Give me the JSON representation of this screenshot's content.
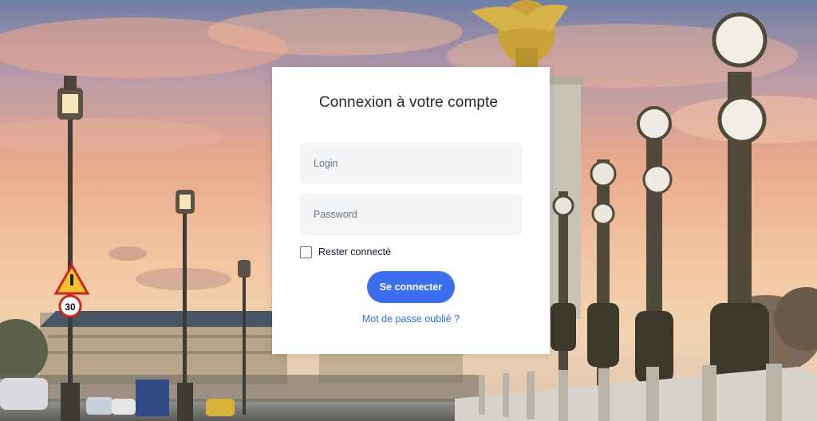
{
  "login_card": {
    "title": "Connexion à votre compte",
    "login_placeholder": "Login",
    "password_placeholder": "Password",
    "remember_label": "Rester connecté",
    "remember_checked": false,
    "submit_label": "Se connecter",
    "forgot_label": "Mot de passe oublié ?"
  },
  "background": {
    "speed_limit_sign": "30"
  },
  "colors": {
    "accent": "#3b6ff0",
    "link": "#2f6fe0",
    "field_bg": "#f3f4f6",
    "card_bg": "#ffffff",
    "sky_top": "#7a86a8",
    "sky_mid": "#e9a88a",
    "sky_low": "#f3c9a0"
  }
}
